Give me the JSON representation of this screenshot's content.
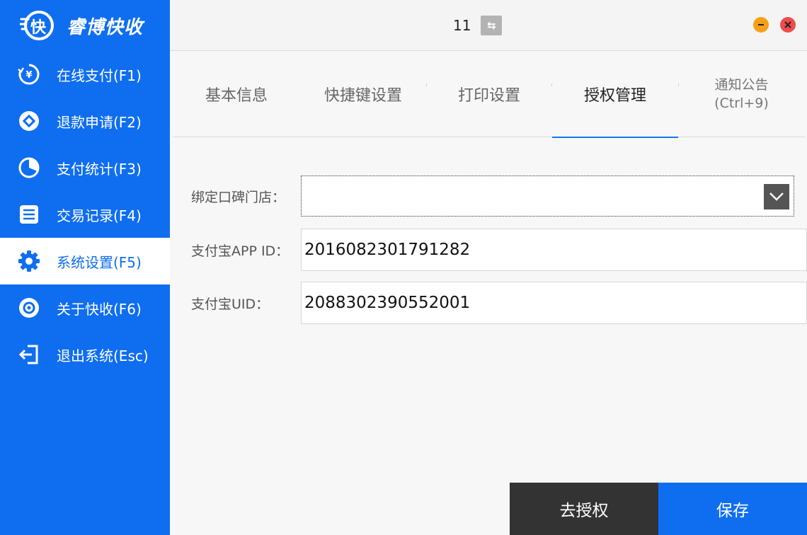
{
  "app": {
    "logo_char": "快",
    "name": "睿博快收"
  },
  "sidebar": {
    "items": [
      {
        "label": "在线支付(F1)",
        "icon": "yuan-icon"
      },
      {
        "label": "退款申请(F2)",
        "icon": "refund-icon"
      },
      {
        "label": "支付统计(F3)",
        "icon": "pie-chart-icon"
      },
      {
        "label": "交易记录(F4)",
        "icon": "list-icon"
      },
      {
        "label": "系统设置(F5)",
        "icon": "gear-icon"
      },
      {
        "label": "关于快收(F6)",
        "icon": "eye-icon"
      },
      {
        "label": "退出系统(Esc)",
        "icon": "logout-icon"
      }
    ],
    "active_index": 4
  },
  "topbar": {
    "number": "11",
    "swap_icon": "swap-icon",
    "minimize_icon": "minimize-icon",
    "close_icon": "close-icon"
  },
  "tabs": [
    {
      "label": "基本信息"
    },
    {
      "label": "快捷键设置"
    },
    {
      "label": "打印设置"
    },
    {
      "label": "授权管理"
    },
    {
      "label_line1": "通知公告",
      "label_line2": "(Ctrl+9)"
    }
  ],
  "form": {
    "store": {
      "label": "绑定口碑门店：",
      "value": ""
    },
    "app_id": {
      "label": "支付宝APP ID：",
      "value": "2016082301791282"
    },
    "uid": {
      "label": "支付宝UID：",
      "value": "2088302390552001"
    }
  },
  "buttons": {
    "deauth": "去授权",
    "save": "保存"
  },
  "colors": {
    "primary": "#0f6ef0",
    "dark_button": "#333333",
    "minimize": "#f6a01a",
    "close": "#ef4c4c"
  }
}
